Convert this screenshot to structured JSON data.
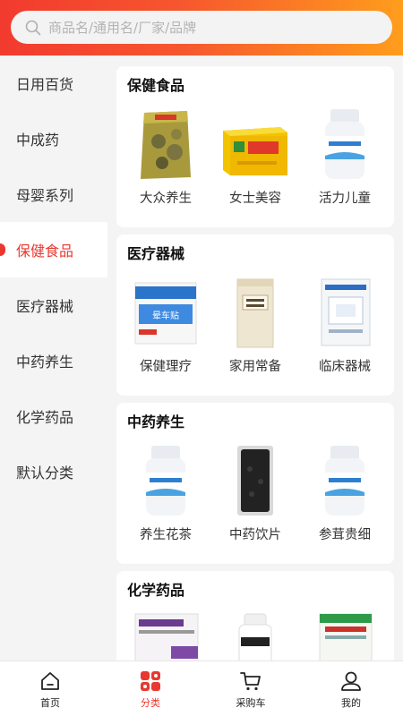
{
  "search": {
    "placeholder": "商品名/通用名/厂家/品牌"
  },
  "sidebar": {
    "items": [
      {
        "label": "日用百货"
      },
      {
        "label": "中成药"
      },
      {
        "label": "母婴系列"
      },
      {
        "label": "保健食品",
        "active": true
      },
      {
        "label": "医疗器械"
      },
      {
        "label": "中药养生"
      },
      {
        "label": "化学药品"
      },
      {
        "label": "默认分类"
      }
    ]
  },
  "sections": [
    {
      "title": "保健食品",
      "products": [
        {
          "label": "大众养生",
          "icon": "herb-bag-image"
        },
        {
          "label": "女士美容",
          "icon": "yellow-box-image"
        },
        {
          "label": "活力儿童",
          "icon": "pill-bottle-image"
        }
      ]
    },
    {
      "title": "医疗器械",
      "products": [
        {
          "label": "保健理疗",
          "icon": "patch-box-image",
          "badge_text": "晕车贴"
        },
        {
          "label": "家用常备",
          "icon": "paper-pack-image"
        },
        {
          "label": "临床器械",
          "icon": "dressing-pack-image"
        }
      ]
    },
    {
      "title": "中药养生",
      "products": [
        {
          "label": "养生花茶",
          "icon": "pill-bottle-image"
        },
        {
          "label": "中药饮片",
          "icon": "black-herb-bag-image"
        },
        {
          "label": "参茸贵细",
          "icon": "pill-bottle-image"
        }
      ]
    },
    {
      "title": "化学药品",
      "products": [
        {
          "label": "",
          "icon": "medicine-box-image"
        },
        {
          "label": "",
          "icon": "tablet-bottle-image"
        },
        {
          "label": "",
          "icon": "green-medicine-box-image"
        }
      ]
    }
  ],
  "tabbar": {
    "items": [
      {
        "label": "首页",
        "icon": "home-icon"
      },
      {
        "label": "分类",
        "icon": "category-icon",
        "active": true
      },
      {
        "label": "采购车",
        "icon": "cart-icon"
      },
      {
        "label": "我的",
        "icon": "user-icon"
      }
    ]
  },
  "colors": {
    "accent": "#e8382f",
    "gradient_start": "#f23a2f",
    "gradient_end": "#ff9d1c"
  }
}
